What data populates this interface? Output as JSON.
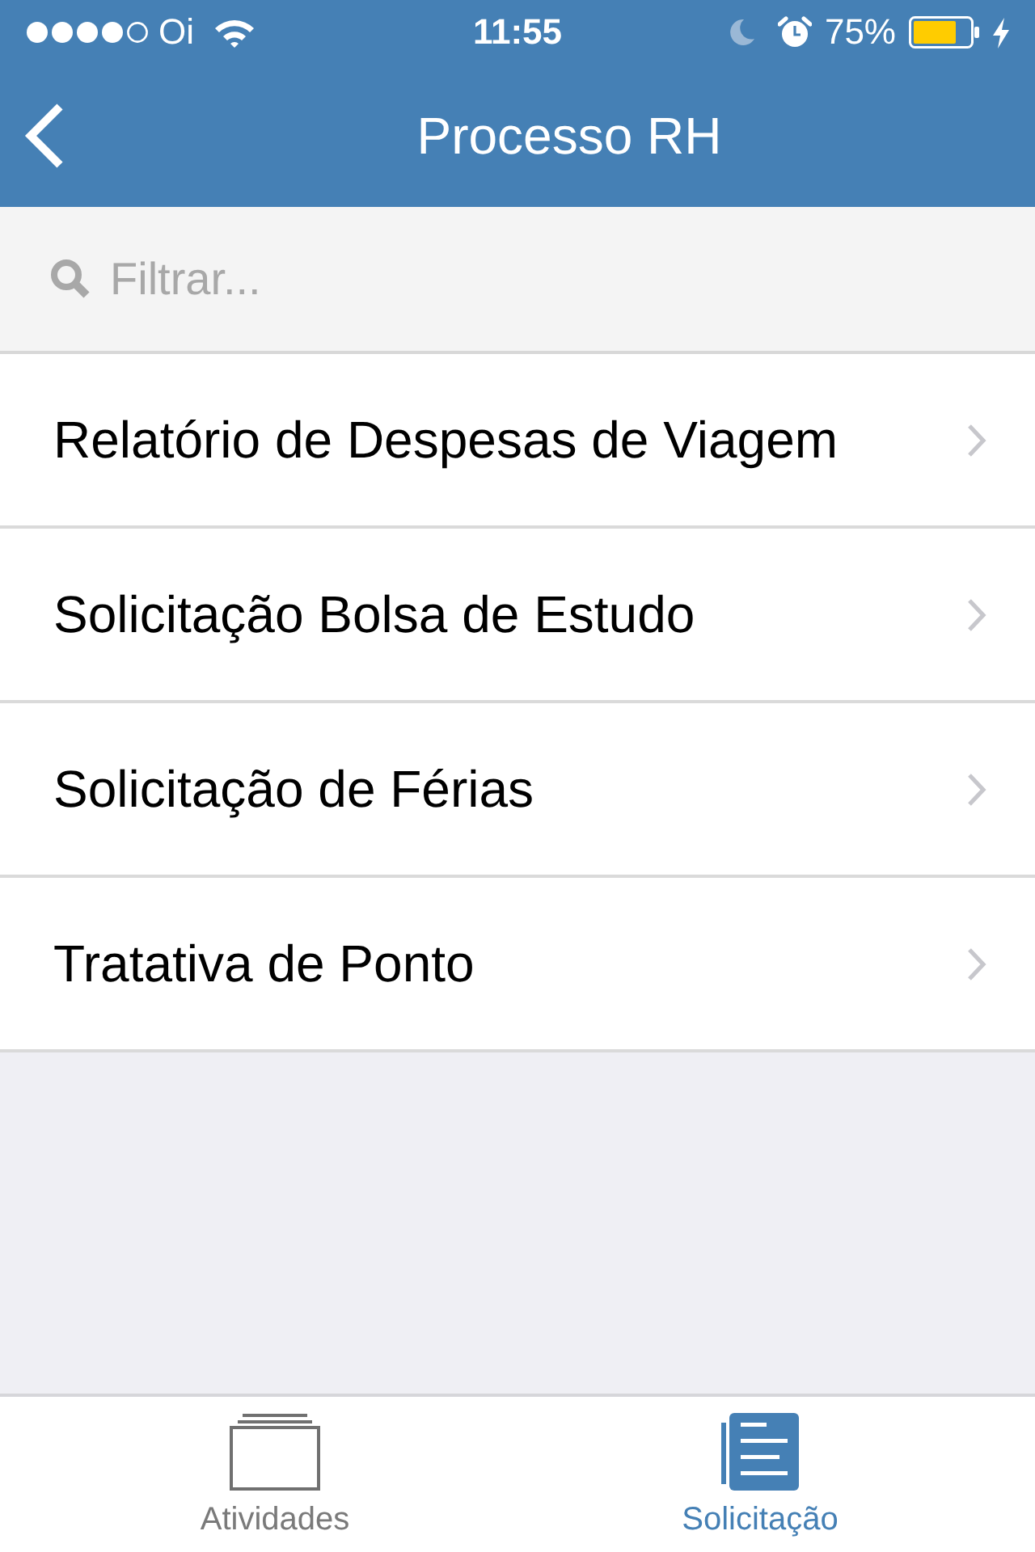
{
  "status_bar": {
    "carrier": "Oi",
    "time": "11:55",
    "battery": "75%"
  },
  "nav_bar": {
    "title": "Processo RH"
  },
  "search": {
    "placeholder": "Filtrar..."
  },
  "list": {
    "items": [
      {
        "label": "Relatório de Despesas de Viagem"
      },
      {
        "label": "Solicitação Bolsa de Estudo"
      },
      {
        "label": "Solicitação de Férias"
      },
      {
        "label": "Tratativa de Ponto"
      }
    ]
  },
  "tab_bar": {
    "tabs": [
      {
        "label": "Atividades",
        "selected": false
      },
      {
        "label": "Solicitação",
        "selected": true
      }
    ]
  }
}
